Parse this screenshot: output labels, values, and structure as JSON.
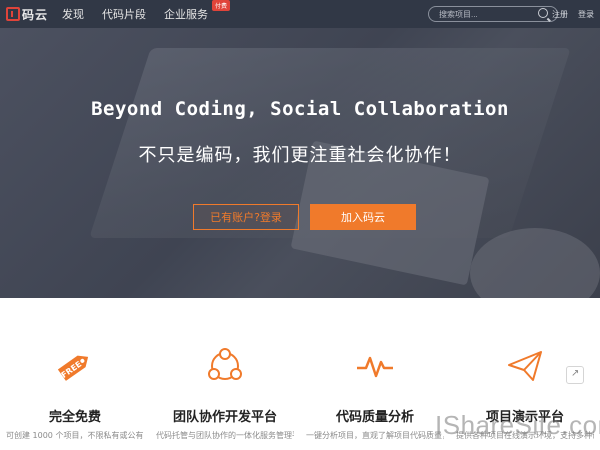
{
  "nav": {
    "logo_text": "码云",
    "items": [
      {
        "label": "发现"
      },
      {
        "label": "代码片段"
      },
      {
        "label": "企业服务",
        "badge": "付费"
      }
    ],
    "search_placeholder": "搜索项目...",
    "register": "注册",
    "login": "登录"
  },
  "hero": {
    "title": "Beyond Coding, Social Collaboration",
    "subtitle": "不只是编码，我们更注重社会化协作！",
    "login_button": "已有账户?登录",
    "join_button": "加入码云"
  },
  "features": [
    {
      "title": "完全免费",
      "desc": "可创建 1000 个项目，不限私有或公有，支持 SSH、HTTP 和 SVN",
      "icon": "free-tag-icon"
    },
    {
      "title": "团队协作开发平台",
      "desc": "代码托管与团队协作的一体化服务管理平台，轻松管理项目和团队",
      "icon": "team-network-icon"
    },
    {
      "title": "代码质量分析",
      "desc": "一键分析项目，直观了解项目代码质量，支持Sonar，代码安全卫士",
      "icon": "pulse-icon"
    },
    {
      "title": "项目演示平台",
      "desc": "提供各种项目在线演示环境，支持多种语言框架及数据库服务",
      "icon": "paper-plane-icon"
    }
  ],
  "watermark": "IShareSite.com",
  "colors": {
    "accent": "#f07a2b",
    "navbar": "#313846",
    "brand_red": "#e0443a"
  }
}
